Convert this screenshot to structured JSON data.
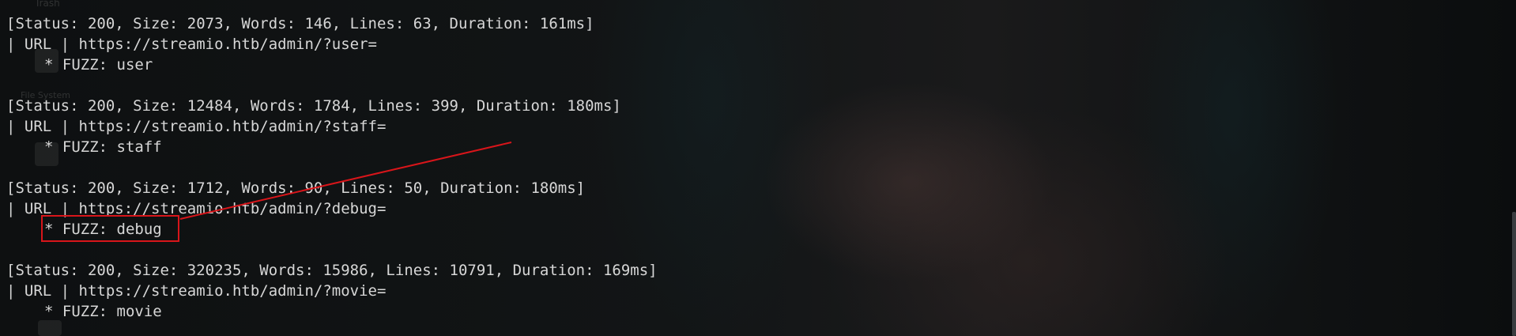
{
  "desktop": {
    "trash_label": "Trash",
    "filesystem_label": "File System"
  },
  "results": [
    {
      "status_line": "[Status: 200, Size: 2073, Words: 146, Lines: 63, Duration: 161ms]",
      "url_line": "| URL | https://streamio.htb/admin/?user=",
      "fuzz_line": "* FUZZ: user"
    },
    {
      "status_line": "[Status: 200, Size: 12484, Words: 1784, Lines: 399, Duration: 180ms]",
      "url_line": "| URL | https://streamio.htb/admin/?staff=",
      "fuzz_line": "* FUZZ: staff"
    },
    {
      "status_line": "[Status: 200, Size: 1712, Words: 90, Lines: 50, Duration: 180ms]",
      "url_line": "| URL | https://streamio.htb/admin/?debug=",
      "fuzz_line": "* FUZZ: debug"
    },
    {
      "status_line": "[Status: 200, Size: 320235, Words: 15986, Lines: 10791, Duration: 169ms]",
      "url_line": "| URL | https://streamio.htb/admin/?movie=",
      "fuzz_line": "* FUZZ: movie"
    }
  ],
  "annotation": {
    "color": "#d8151a"
  },
  "colors": {
    "text": "#d7d7d7",
    "background": "#0d0f10"
  }
}
